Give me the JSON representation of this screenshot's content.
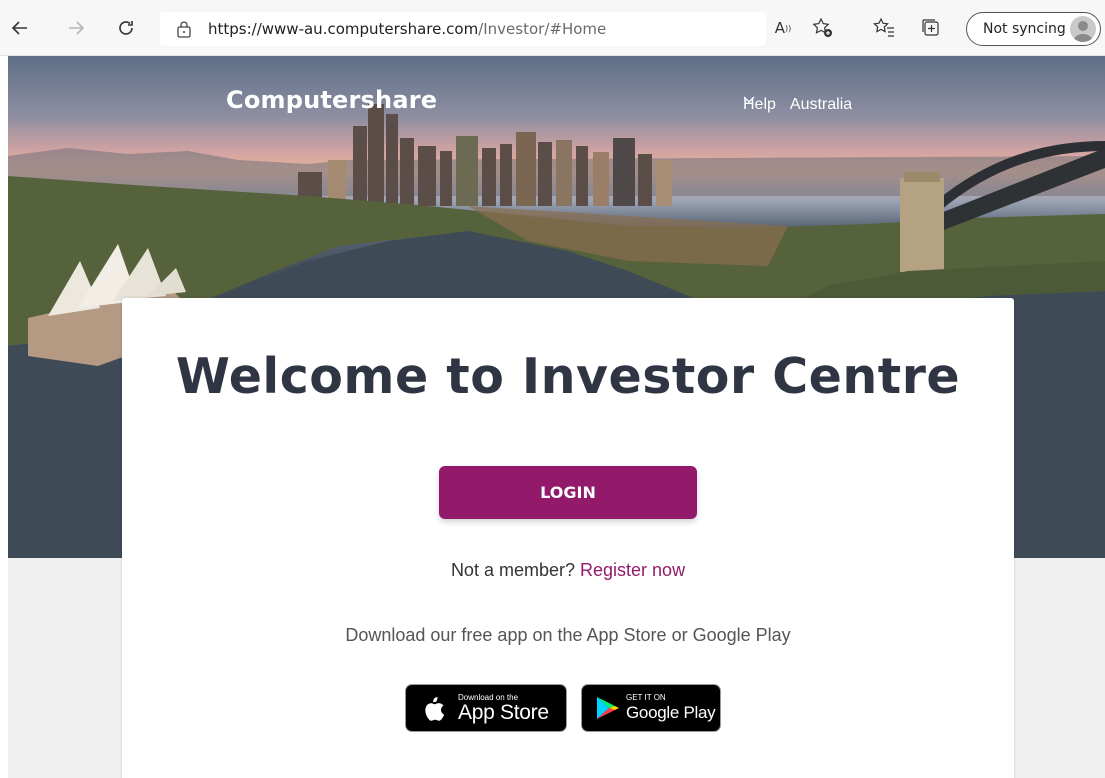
{
  "browser": {
    "url_host": "https://www-au.computershare.com",
    "url_path": "/Investor/#Home",
    "read_aloud_label": "A",
    "sync_label": "Not syncing"
  },
  "header": {
    "brand": "Computershare",
    "help": "Help",
    "country": "Australia"
  },
  "main": {
    "title": "Welcome to Investor Centre",
    "login_label": "LOGIN",
    "member_prompt": "Not a member?",
    "register_link": "Register now",
    "download_text": "Download our free app on the App Store or Google Play",
    "app_store_small": "Download on the",
    "app_store_big": "App Store",
    "google_small": "GET IT ON",
    "google_big": "Google Play"
  },
  "colors": {
    "accent": "#931a6b",
    "title": "#2f3542"
  }
}
